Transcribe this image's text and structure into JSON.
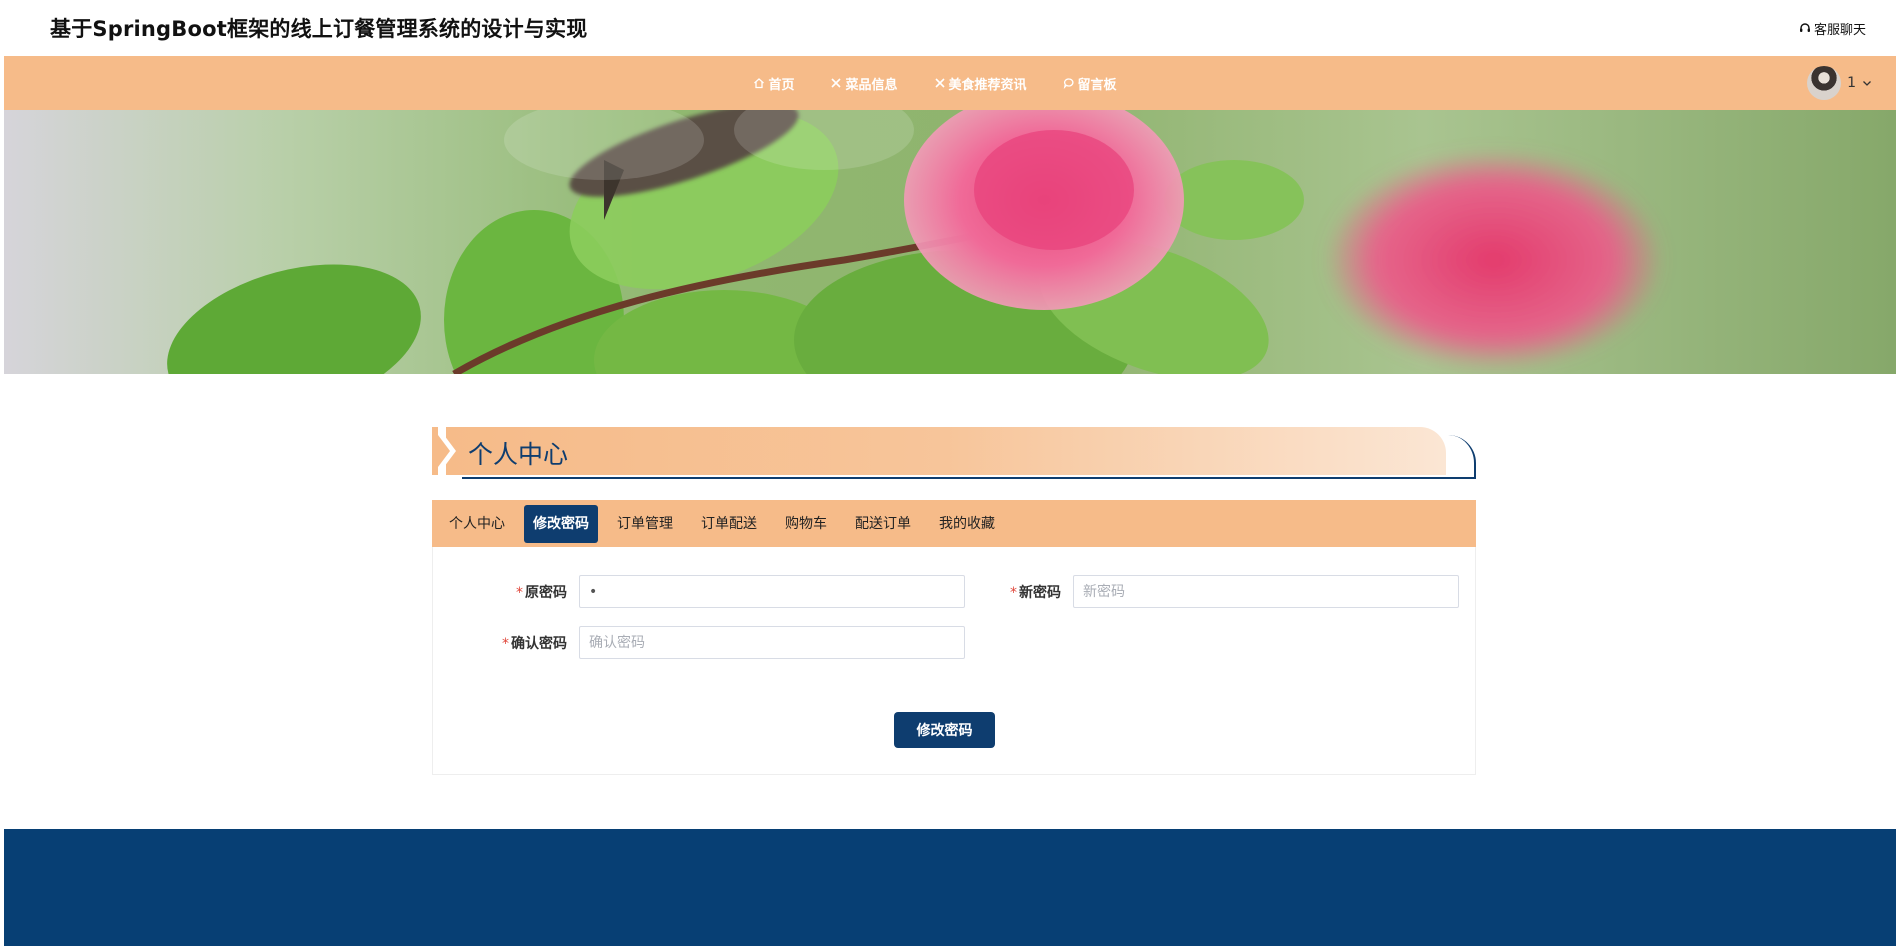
{
  "header": {
    "title": "基于SpringBoot框架的线上订餐管理系统的设计与实现",
    "chat_label": "客服聊天"
  },
  "nav": {
    "items": [
      {
        "label": "首页",
        "icon": "home-icon"
      },
      {
        "label": "菜品信息",
        "icon": "utensils-icon"
      },
      {
        "label": "美食推荐资讯",
        "icon": "utensils-icon"
      },
      {
        "label": "留言板",
        "icon": "message-icon"
      }
    ],
    "user": {
      "name": "1"
    }
  },
  "section": {
    "title": "个人中心"
  },
  "tabs": [
    {
      "label": "个人中心",
      "active": false
    },
    {
      "label": "修改密码",
      "active": true
    },
    {
      "label": "订单管理",
      "active": false
    },
    {
      "label": "订单配送",
      "active": false
    },
    {
      "label": "购物车",
      "active": false
    },
    {
      "label": "配送订单",
      "active": false
    },
    {
      "label": "我的收藏",
      "active": false
    }
  ],
  "form": {
    "old_password": {
      "label": "原密码",
      "value": "•"
    },
    "new_password": {
      "label": "新密码",
      "placeholder": "新密码"
    },
    "confirm_password": {
      "label": "确认密码",
      "placeholder": "确认密码"
    },
    "required_mark": "*",
    "submit_label": "修改密码"
  },
  "colors": {
    "accent": "#f6bb89",
    "primary": "#0e3d6f",
    "footer": "#073f74"
  }
}
